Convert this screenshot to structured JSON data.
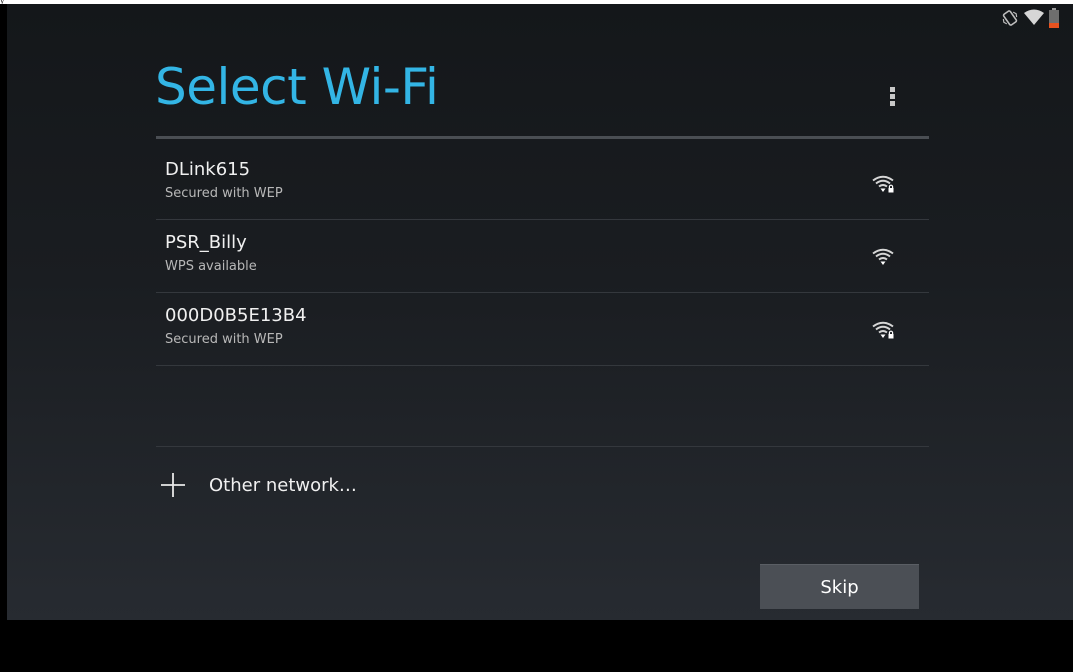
{
  "page": {
    "title": "Select Wi-Fi",
    "corner_text": "y"
  },
  "colors": {
    "title": "#33b5e5",
    "background_top": "#14171a",
    "background_bottom": "#272b31",
    "battery_low": "#e6521f"
  },
  "status_bar": {
    "icons": [
      "vibrate-icon",
      "wifi-status-icon",
      "battery-icon"
    ]
  },
  "menu": {
    "icon": "overflow-menu-icon"
  },
  "networks": [
    {
      "ssid": "DLink615",
      "summary": "Secured with WEP",
      "secured": true,
      "icon": "wifi-secured-icon"
    },
    {
      "ssid": "PSR_Billy",
      "summary": "WPS available",
      "secured": false,
      "icon": "wifi-icon"
    },
    {
      "ssid": "000D0B5E13B4",
      "summary": "Secured with WEP",
      "secured": true,
      "icon": "wifi-secured-icon"
    }
  ],
  "other_network": {
    "label": "Other network…",
    "icon": "add-icon"
  },
  "actions": {
    "skip_label": "Skip"
  }
}
